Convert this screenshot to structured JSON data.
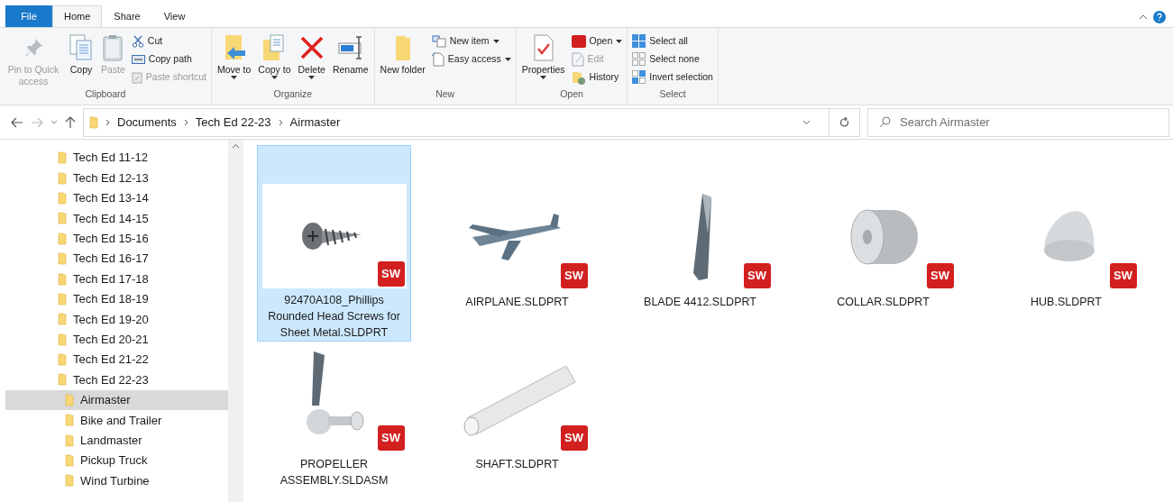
{
  "ribbon_tabs": [
    {
      "label": "File",
      "kind": "file",
      "selected": false
    },
    {
      "label": "Home",
      "kind": "tab",
      "selected": true
    },
    {
      "label": "Share",
      "kind": "tab",
      "selected": false
    },
    {
      "label": "View",
      "kind": "tab",
      "selected": false
    }
  ],
  "ribbon_groups": [
    {
      "label": "Clipboard",
      "items": [
        {
          "kind": "large",
          "label": "Pin to Quick access",
          "disabled": true,
          "has_menu": false
        },
        {
          "kind": "large",
          "label": "Copy",
          "disabled": false,
          "has_menu": false
        },
        {
          "kind": "large",
          "label": "Paste",
          "disabled": true,
          "has_menu": false
        },
        {
          "kind": "stack",
          "items": [
            {
              "label": "Cut",
              "disabled": false,
              "has_menu": false
            },
            {
              "label": "Copy path",
              "disabled": false,
              "has_menu": false
            },
            {
              "label": "Paste shortcut",
              "disabled": true,
              "has_menu": false
            }
          ]
        }
      ]
    },
    {
      "label": "Organize",
      "items": [
        {
          "kind": "large",
          "label": "Move to",
          "disabled": false,
          "has_menu": true
        },
        {
          "kind": "large",
          "label": "Copy to",
          "disabled": false,
          "has_menu": true
        },
        {
          "kind": "large",
          "label": "Delete",
          "disabled": false,
          "has_menu": true
        },
        {
          "kind": "large",
          "label": "Rename",
          "disabled": false,
          "has_menu": false
        }
      ]
    },
    {
      "label": "New",
      "items": [
        {
          "kind": "large",
          "label": "New folder",
          "disabled": false,
          "has_menu": false
        },
        {
          "kind": "stack",
          "items": [
            {
              "label": "New item",
              "disabled": false,
              "has_menu": true
            },
            {
              "label": "Easy access",
              "disabled": false,
              "has_menu": true
            }
          ]
        }
      ]
    },
    {
      "label": "Open",
      "items": [
        {
          "kind": "large",
          "label": "Properties",
          "disabled": false,
          "has_menu": true
        },
        {
          "kind": "stack",
          "items": [
            {
              "label": "Open",
              "disabled": false,
              "has_menu": true
            },
            {
              "label": "Edit",
              "disabled": true,
              "has_menu": false
            },
            {
              "label": "History",
              "disabled": false,
              "has_menu": false
            }
          ]
        }
      ]
    },
    {
      "label": "Select",
      "items": [
        {
          "kind": "stack",
          "items": [
            {
              "label": "Select all",
              "disabled": false,
              "has_menu": false
            },
            {
              "label": "Select none",
              "disabled": false,
              "has_menu": false
            },
            {
              "label": "Invert selection",
              "disabled": false,
              "has_menu": false
            }
          ]
        }
      ]
    }
  ],
  "address_bar": {
    "crumbs": [
      "Documents",
      "Tech Ed 22-23",
      "Airmaster"
    ]
  },
  "search": {
    "placeholder": "Search Airmaster"
  },
  "sidebar": {
    "items": [
      {
        "label": "Tech Ed 11-12",
        "selected": false
      },
      {
        "label": "Tech Ed 12-13",
        "selected": false
      },
      {
        "label": "Tech Ed 13-14",
        "selected": false
      },
      {
        "label": "Tech Ed 14-15",
        "selected": false
      },
      {
        "label": "Tech Ed 15-16",
        "selected": false
      },
      {
        "label": "Tech Ed 16-17",
        "selected": false
      },
      {
        "label": "Tech Ed 17-18",
        "selected": false
      },
      {
        "label": "Tech Ed 18-19",
        "selected": false
      },
      {
        "label": "Tech Ed 19-20",
        "selected": false
      },
      {
        "label": "Tech Ed 20-21",
        "selected": false
      },
      {
        "label": "Tech Ed 21-22",
        "selected": false
      },
      {
        "label": "Tech Ed 22-23",
        "selected": false,
        "children": [
          {
            "label": "Airmaster",
            "selected": true
          },
          {
            "label": "Bike and Trailer",
            "selected": false
          },
          {
            "label": "Landmaster",
            "selected": false
          },
          {
            "label": "Pickup Truck",
            "selected": false
          },
          {
            "label": "Wind Turbine",
            "selected": false
          }
        ]
      }
    ]
  },
  "files": [
    {
      "name": "92470A108_Phillips Rounded Head Screws for Sheet Metal.SLDPRT",
      "badge": "SW",
      "selected": true
    },
    {
      "name": "AIRPLANE.SLDPRT",
      "badge": "SW",
      "selected": false
    },
    {
      "name": "BLADE 4412.SLDPRT",
      "badge": "SW",
      "selected": false
    },
    {
      "name": "COLLAR.SLDPRT",
      "badge": "SW",
      "selected": false
    },
    {
      "name": "HUB.SLDPRT",
      "badge": "SW",
      "selected": false
    },
    {
      "name": "PROPELLER ASSEMBLY.SLDASM",
      "badge": "SW",
      "selected": false
    },
    {
      "name": "SHAFT.SLDPRT",
      "badge": "SW",
      "selected": false
    }
  ]
}
